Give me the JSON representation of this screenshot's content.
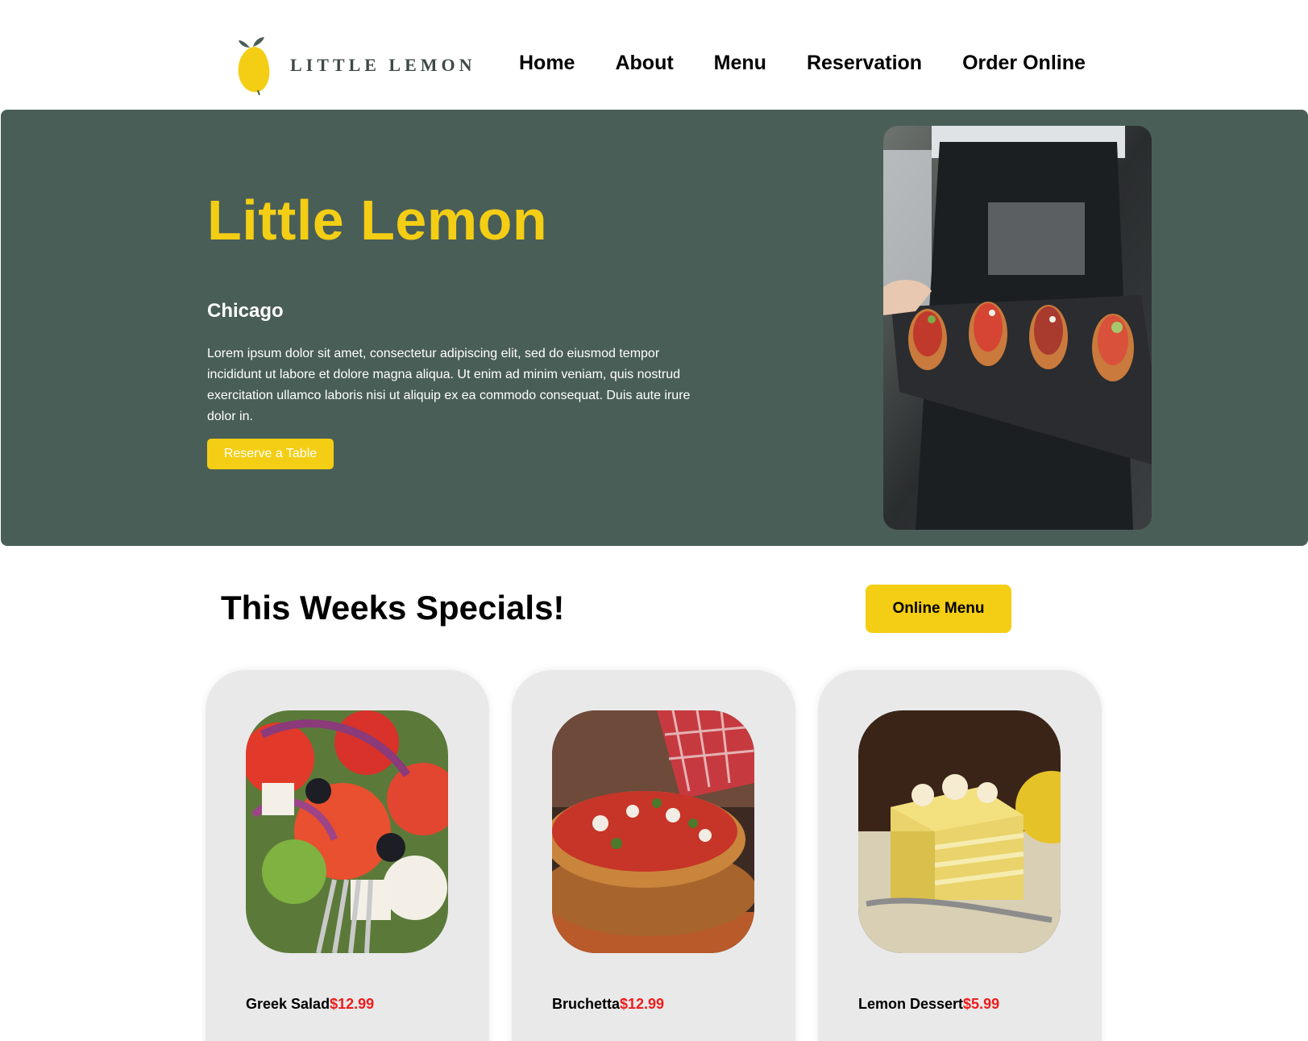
{
  "brand": {
    "logo_text": "LITTLE LEMON",
    "accent": "#f4ce14",
    "primary": "#495e57"
  },
  "nav": {
    "items": [
      {
        "label": "Home"
      },
      {
        "label": "About"
      },
      {
        "label": "Menu"
      },
      {
        "label": "Reservation"
      },
      {
        "label": "Order Online"
      }
    ]
  },
  "hero": {
    "title": "Little Lemon",
    "subtitle": "Chicago",
    "description": "Lorem ipsum dolor sit amet, consectetur adipiscing elit, sed do eiusmod tempor incididunt ut labore et dolore magna aliqua. Ut enim ad minim veniam, quis nostrud exercitation ullamco laboris nisi ut aliquip ex ea commodo consequat. Duis aute irure dolor in.",
    "cta_label": "Reserve a Table",
    "image_icon": "restaurant-food-photo"
  },
  "specials": {
    "title": "This Weeks Specials!",
    "menu_button_label": "Online Menu",
    "price_color": "#ee1c1c",
    "items": [
      {
        "name": "Greek Salad",
        "price": "$12.99",
        "image_icon": "greek-salad-photo"
      },
      {
        "name": "Bruchetta",
        "price": "$12.99",
        "image_icon": "bruschetta-photo"
      },
      {
        "name": "Lemon Dessert",
        "price": "$5.99",
        "image_icon": "lemon-dessert-photo"
      }
    ]
  }
}
